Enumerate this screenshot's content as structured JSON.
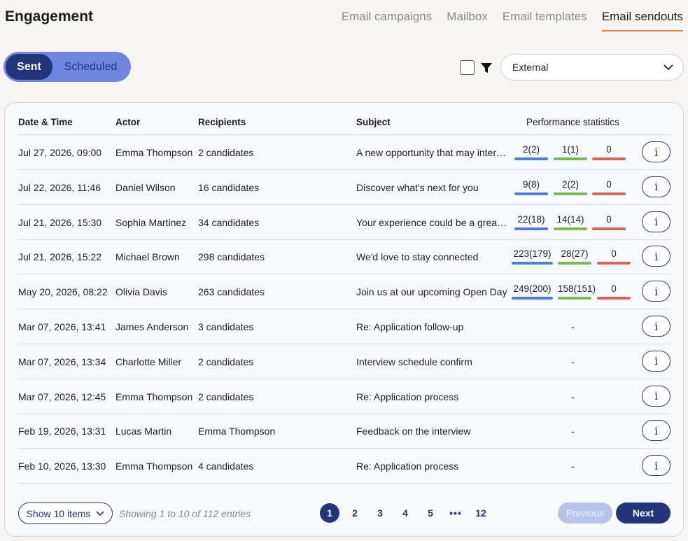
{
  "header": {
    "title": "Engagement",
    "tabs": [
      "Email campaigns",
      "Mailbox",
      "Email templates",
      "Email sendouts"
    ],
    "active_tab": "Email sendouts"
  },
  "toggle": {
    "sent": "Sent",
    "scheduled": "Scheduled",
    "active": "Sent"
  },
  "filter": {
    "select_value": "External",
    "icon": "filter-icon"
  },
  "colors": {
    "accent": "#233579",
    "tab_underline": "#e8833a",
    "bar_blue": "#4f7be0",
    "bar_green": "#7ab85a",
    "bar_red": "#d9635a"
  },
  "table": {
    "headers": [
      "Date & Time",
      "Actor",
      "Recipients",
      "Subject",
      "Performance statistics"
    ],
    "rows": [
      {
        "date": "Jul 27, 2026, 09:00",
        "actor": "Emma Thompson",
        "recipients": "2 candidates",
        "subject": "A new opportunity that may interest you",
        "stats": [
          "2(2)",
          "1(1)",
          "0"
        ]
      },
      {
        "date": "Jul 22, 2026, 11:46",
        "actor": "Daniel Wilson",
        "recipients": "16 candidates",
        "subject": "Discover what's next for you",
        "stats": [
          "9(8)",
          "2(2)",
          "0"
        ]
      },
      {
        "date": "Jul 21, 2026, 15:30",
        "actor": "Sophia Martinez",
        "recipients": "34 candidates",
        "subject": "Your experience could be a great fit",
        "stats": [
          "22(18)",
          "14(14)",
          "0"
        ]
      },
      {
        "date": "Jul 21, 2026, 15:22",
        "actor": "Michael Brown",
        "recipients": "298 candidates",
        "subject": "We'd love to stay connected",
        "stats": [
          "223(179)",
          "28(27)",
          "0"
        ]
      },
      {
        "date": "May 20, 2026, 08:22",
        "actor": "Olivia Davis",
        "recipients": "263 candidates",
        "subject": "Join us at our upcoming Open Day",
        "stats": [
          "249(200)",
          "158(151)",
          "0"
        ]
      },
      {
        "date": "Mar 07, 2026, 13:41",
        "actor": "James Anderson",
        "recipients": "3 candidates",
        "subject": "Re: Application follow-up",
        "stats": null,
        "dash": "-"
      },
      {
        "date": "Mar 07, 2026, 13:34",
        "actor": "Charlotte Miller",
        "recipients": "2 candidates",
        "subject": "Interview schedule confirm",
        "stats": null,
        "dash": "-"
      },
      {
        "date": "Mar 07, 2026, 12:45",
        "actor": "Emma Thompson",
        "recipients": "2 candidates",
        "subject": "Re: Application process",
        "stats": null,
        "dash": "-"
      },
      {
        "date": "Feb 19, 2026, 13:31",
        "actor": "Lucas Martin",
        "recipients": "Emma Thompson",
        "subject": "Feedback on the interview",
        "stats": null,
        "dash": "-"
      },
      {
        "date": "Feb 10, 2026, 13:30",
        "actor": "Emma Thompson",
        "recipients": "4 candidates",
        "subject": "Re: Application process",
        "stats": null,
        "dash": "-"
      }
    ],
    "info_label": "i"
  },
  "footer": {
    "show_items": "Show 10 items",
    "entries_text": "Showing 1 to 10 of 112 entries",
    "pages": [
      "1",
      "2",
      "3",
      "4",
      "5",
      "•••",
      "12"
    ],
    "current_page": "1",
    "previous": "Previous",
    "next": "Next"
  }
}
